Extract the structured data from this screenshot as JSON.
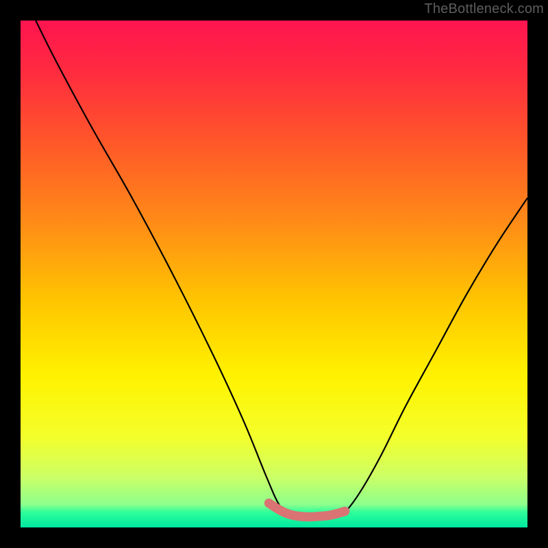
{
  "watermark": "TheBottleneck.com",
  "chart_data": {
    "type": "line",
    "title": "",
    "xlabel": "",
    "ylabel": "",
    "xlim": [
      0,
      100
    ],
    "ylim": [
      0,
      100
    ],
    "gradient_stops": [
      {
        "pos": 0.0,
        "color": "#ff1450"
      },
      {
        "pos": 0.1,
        "color": "#ff2b3f"
      },
      {
        "pos": 0.25,
        "color": "#ff5a28"
      },
      {
        "pos": 0.4,
        "color": "#ff8c17"
      },
      {
        "pos": 0.55,
        "color": "#ffc400"
      },
      {
        "pos": 0.7,
        "color": "#fff200"
      },
      {
        "pos": 0.82,
        "color": "#f4ff2a"
      },
      {
        "pos": 0.9,
        "color": "#ccff66"
      },
      {
        "pos": 0.955,
        "color": "#8cff8c"
      },
      {
        "pos": 0.97,
        "color": "#2eff9a"
      },
      {
        "pos": 1.0,
        "color": "#00e6a0"
      }
    ],
    "series": [
      {
        "name": "bottleneck-curve",
        "stroke": "#000000",
        "stroke_width": 2.2,
        "fill": "none",
        "x": [
          3.0,
          7.0,
          14.0,
          22.0,
          30.0,
          38.0,
          44.0,
          48.5,
          51.0,
          53.0,
          55.0,
          58.0,
          60.5,
          63.0,
          64.0,
          67.0,
          71.0,
          76.0,
          82.0,
          88.0,
          94.0,
          100.0
        ],
        "y": [
          100.0,
          92.0,
          79.0,
          65.0,
          50.0,
          34.0,
          21.0,
          10.0,
          4.5,
          2.5,
          2.0,
          2.0,
          2.3,
          2.8,
          3.0,
          7.0,
          14.0,
          24.0,
          35.0,
          46.0,
          56.0,
          65.0
        ]
      },
      {
        "name": "optimum-band",
        "stroke": "#da7373",
        "stroke_width": 13.5,
        "linecap": "round",
        "fill": "none",
        "x": [
          49.0,
          51.0,
          53.0,
          55.0,
          57.0,
          59.0,
          61.0,
          63.0,
          64.0
        ],
        "y": [
          4.8,
          3.5,
          2.6,
          2.2,
          2.1,
          2.2,
          2.4,
          2.9,
          3.2
        ]
      }
    ]
  }
}
